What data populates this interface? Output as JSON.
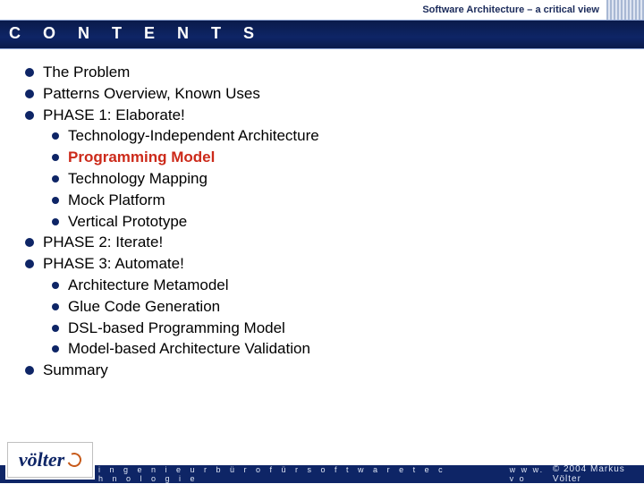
{
  "topbar": {
    "subtitle": "Software Architecture – a critical view"
  },
  "title": "C O N T E N T S",
  "items": [
    {
      "text": "The Problem"
    },
    {
      "text": "Patterns Overview, Known Uses"
    },
    {
      "text": "PHASE 1: Elaborate!",
      "children": [
        {
          "text": "Technology-Independent Architecture"
        },
        {
          "text": "Programming Model",
          "highlight": true
        },
        {
          "text": "Technology Mapping"
        },
        {
          "text": "Mock Platform"
        },
        {
          "text": "Vertical Prototype"
        }
      ]
    },
    {
      "text": "PHASE 2: Iterate!"
    },
    {
      "text": "PHASE 3: Automate!",
      "children": [
        {
          "text": "Architecture Metamodel"
        },
        {
          "text": "Glue Code Generation"
        },
        {
          "text": "DSL-based Programming Model"
        },
        {
          "text": "Model-based Architecture Validation"
        }
      ]
    },
    {
      "text": "Summary"
    }
  ],
  "footer": {
    "tagline": "i n g e n i e u r b ü r o   f ü r   s o f t w a r e t e c h n o l o g i e",
    "url": "w w w. v o",
    "copyright": "© 2004  Markus Völter"
  },
  "logo": {
    "text": "völter"
  }
}
